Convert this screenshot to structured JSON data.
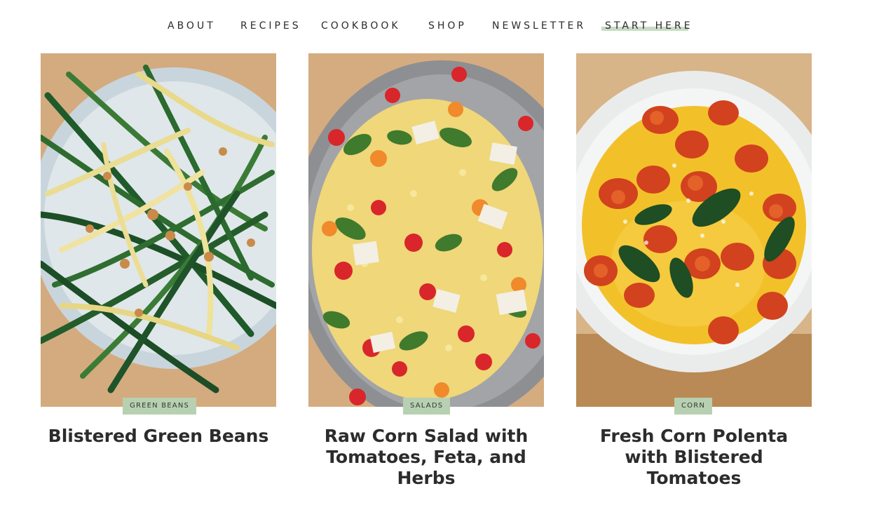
{
  "nav": {
    "items": [
      "ABOUT",
      "RECIPES",
      "COOKBOOK",
      "SHOP",
      "NEWSLETTER",
      "START HERE"
    ],
    "highlight_color": "#c8dcc3"
  },
  "cards": [
    {
      "tag": "GREEN BEANS",
      "title": "Blistered Green Beans",
      "image": "blistered-green-beans-photo"
    },
    {
      "tag": "SALADS",
      "title": "Raw Corn Salad with Tomatoes, Feta, and Herbs",
      "image": "raw-corn-salad-photo"
    },
    {
      "tag": "CORN",
      "title": "Fresh Corn Polenta with Blistered Tomatoes",
      "image": "corn-polenta-photo"
    }
  ],
  "colors": {
    "tag_background": "#b7d0b1",
    "title_text": "#2c2c2c"
  }
}
